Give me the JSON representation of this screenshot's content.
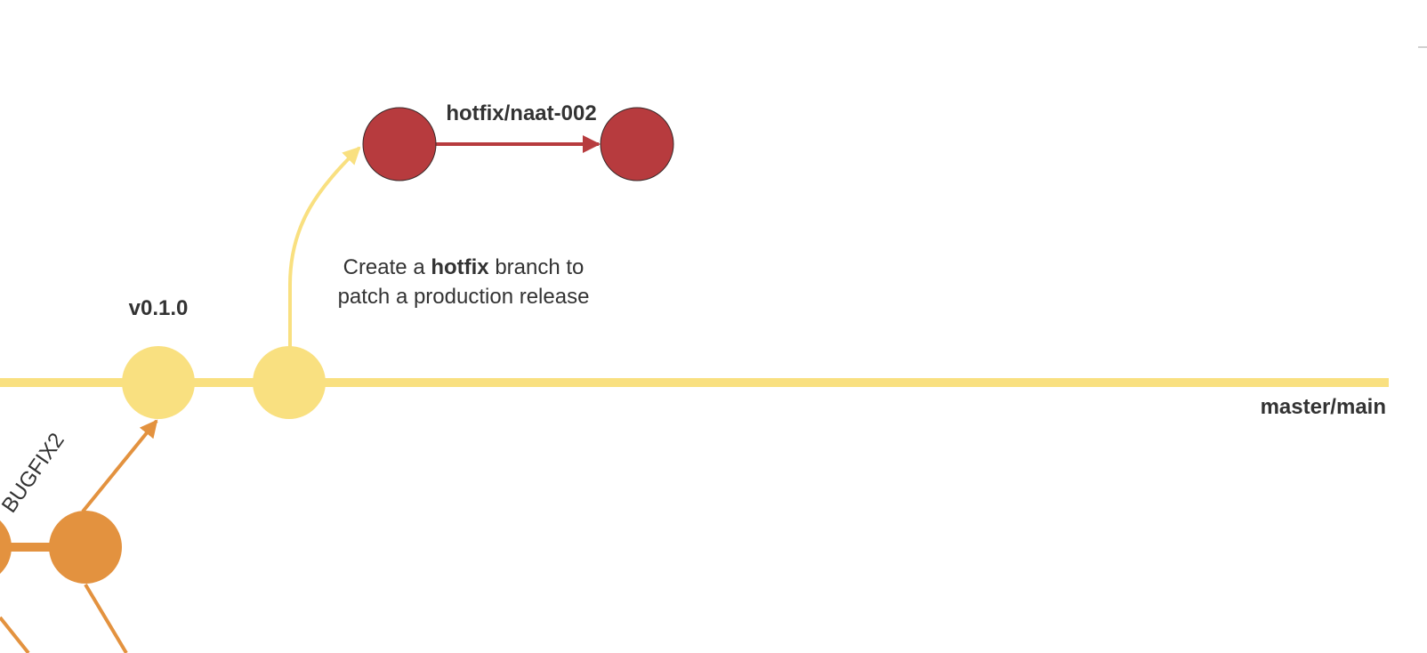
{
  "colors": {
    "master": "#f9e080",
    "release": "#e3923f",
    "hotfix": "#b73b3e",
    "hotfix_stroke": "#3a2a2a",
    "text": "#333333"
  },
  "labels": {
    "tag_v010": "v0.1.0",
    "hotfix_branch": "hotfix/naat-002",
    "master_branch": "master/main",
    "bugfix_branch": "BUGFIX2"
  },
  "annotation": {
    "line1_prefix": "Create a ",
    "line1_bold": "hotfix",
    "line1_suffix": " branch to",
    "line2": "patch a production release"
  }
}
